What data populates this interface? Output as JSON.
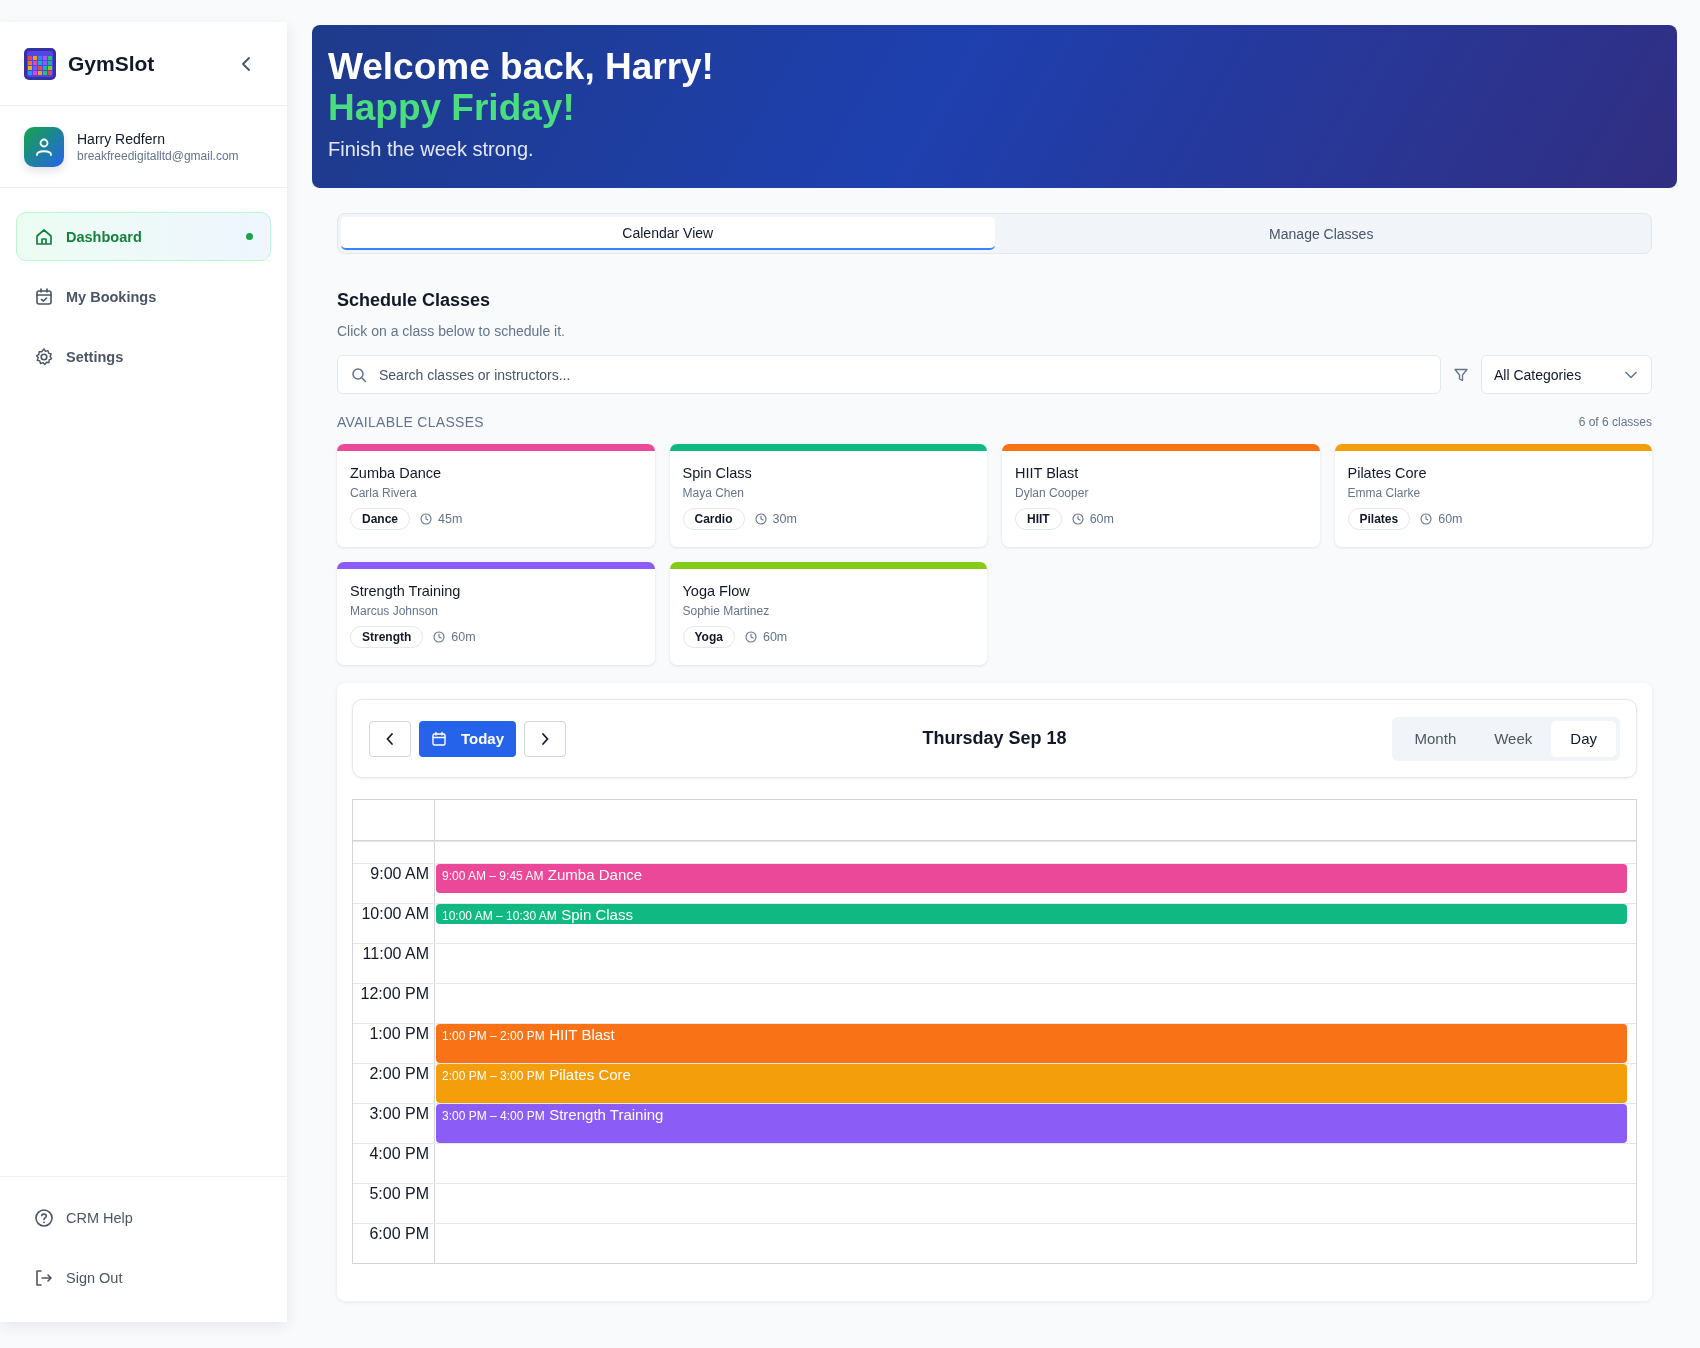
{
  "sidebar": {
    "brand": "GymSlot",
    "user": {
      "name": "Harry Redfern",
      "email": "breakfreedigitalltd@gmail.com"
    },
    "nav": [
      {
        "label": "Dashboard",
        "selected": true
      },
      {
        "label": "My Bookings",
        "selected": false
      },
      {
        "label": "Settings",
        "selected": false
      }
    ],
    "footer": [
      {
        "label": "CRM Help"
      },
      {
        "label": "Sign Out"
      }
    ]
  },
  "banner": {
    "title": "Welcome back, Harry!",
    "greeting": "Happy Friday!",
    "subtitle": "Finish the week strong."
  },
  "tabs": [
    {
      "label": "Calendar View",
      "selected": true
    },
    {
      "label": "Manage Classes",
      "selected": false
    }
  ],
  "schedule": {
    "title": "Schedule Classes",
    "subtitle": "Click on a class below to schedule it.",
    "search": {
      "placeholder": "Search classes or instructors..."
    },
    "category": "All Categories",
    "section_label": "AVAILABLE CLASSES",
    "count": "6 of 6 classes",
    "classes": [
      {
        "name": "Zumba Dance",
        "instructor": "Carla Rivera",
        "category": "Dance",
        "duration": "45m",
        "color": "#ec4899"
      },
      {
        "name": "Spin Class",
        "instructor": "Maya Chen",
        "category": "Cardio",
        "duration": "30m",
        "color": "#10b981"
      },
      {
        "name": "HIIT Blast",
        "instructor": "Dylan Cooper",
        "category": "HIIT",
        "duration": "60m",
        "color": "#f97316"
      },
      {
        "name": "Pilates Core",
        "instructor": "Emma Clarke",
        "category": "Pilates",
        "duration": "60m",
        "color": "#f59e0b"
      },
      {
        "name": "Strength Training",
        "instructor": "Marcus Johnson",
        "category": "Strength",
        "duration": "60m",
        "color": "#8b5cf6"
      },
      {
        "name": "Yoga Flow",
        "instructor": "Sophie Martinez",
        "category": "Yoga",
        "duration": "60m",
        "color": "#84cc16"
      }
    ]
  },
  "calendar": {
    "today": "Today",
    "title": "Thursday Sep 18",
    "views": [
      {
        "label": "Month",
        "selected": false
      },
      {
        "label": "Week",
        "selected": false
      },
      {
        "label": "Day",
        "selected": true
      }
    ],
    "hours": [
      {
        "label": "9:00 AM",
        "events": [
          {
            "time": "9:00 AM – 9:45 AM",
            "title": "Zumba Dance",
            "kind": "medium",
            "color": "#ec4899"
          }
        ]
      },
      {
        "label": "10:00 AM",
        "events": [
          {
            "time": "10:00 AM – 10:30 AM",
            "title": "Spin Class",
            "kind": "short",
            "color": "#10b981"
          }
        ]
      },
      {
        "label": "11:00 AM"
      },
      {
        "label": "12:00 PM"
      },
      {
        "label": "1:00 PM",
        "events": [
          {
            "time": "1:00 PM – 2:00 PM",
            "title": "HIIT Blast",
            "kind": "long",
            "color": "#f97316"
          }
        ]
      },
      {
        "label": "2:00 PM",
        "events": [
          {
            "time": "2:00 PM – 3:00 PM",
            "title": "Pilates Core",
            "kind": "long",
            "color": "#f59e0b"
          }
        ]
      },
      {
        "label": "3:00 PM",
        "events": [
          {
            "time": "3:00 PM – 4:00 PM",
            "title": "Strength Training",
            "kind": "long",
            "color": "#8b5cf6"
          }
        ]
      },
      {
        "label": "4:00 PM"
      },
      {
        "label": "5:00 PM"
      },
      {
        "label": "6:00 PM"
      }
    ]
  }
}
